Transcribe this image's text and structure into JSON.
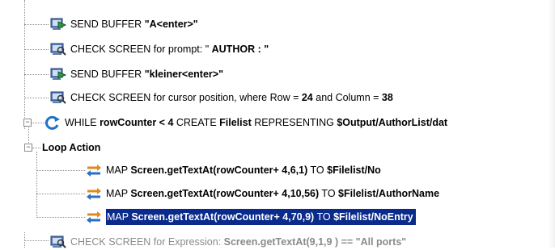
{
  "tree": {
    "selected_index": 8,
    "nodes": [
      {
        "icon": "send-buffer-icon",
        "parts": [
          {
            "t": "SEND BUFFER "
          },
          {
            "t": "\"A<enter>\"",
            "b": true
          }
        ]
      },
      {
        "icon": "check-screen-icon",
        "parts": [
          {
            "t": "CHECK SCREEN for prompt: \"           "
          },
          {
            "t": "AUTHOR : \"",
            "b": true
          }
        ]
      },
      {
        "icon": "send-buffer-icon",
        "parts": [
          {
            "t": "SEND BUFFER "
          },
          {
            "t": "\"kleiner<enter>\"",
            "b": true
          }
        ]
      },
      {
        "icon": "check-screen-icon",
        "parts": [
          {
            "t": "CHECK SCREEN for cursor position, where Row = "
          },
          {
            "t": "24",
            "b": true
          },
          {
            "t": " and Column = "
          },
          {
            "t": "38",
            "b": true
          }
        ]
      },
      {
        "icon": "while-loop-icon",
        "parts": [
          {
            "t": "WHILE "
          },
          {
            "t": "rowCounter < 4",
            "b": true
          },
          {
            "t": " CREATE "
          },
          {
            "t": "Filelist",
            "b": true
          },
          {
            "t": " REPRESENTING "
          },
          {
            "t": "$Output/AuthorList/dat",
            "b": true
          }
        ]
      },
      {
        "icon": "",
        "parts": [
          {
            "t": "Loop Action",
            "b": true
          }
        ]
      },
      {
        "icon": "map-arrows-icon",
        "parts": [
          {
            "t": "MAP "
          },
          {
            "t": "Screen.getTextAt(rowCounter+ 4,6,1)",
            "b": true
          },
          {
            "t": " TO "
          },
          {
            "t": "$Filelist/No",
            "b": true
          }
        ]
      },
      {
        "icon": "map-arrows-icon",
        "parts": [
          {
            "t": "MAP "
          },
          {
            "t": "Screen.getTextAt(rowCounter+ 4,10,56)",
            "b": true
          },
          {
            "t": " TO "
          },
          {
            "t": "$Filelist/AuthorName",
            "b": true
          }
        ]
      },
      {
        "icon": "map-arrows-icon",
        "parts": [
          {
            "t": "MAP "
          },
          {
            "t": "Screen.getTextAt(rowCounter+ 4,70,9)",
            "b": true
          },
          {
            "t": " TO "
          },
          {
            "t": "$Filelist/NoEntry",
            "b": true
          }
        ]
      },
      {
        "icon": "check-screen-icon",
        "parts": [
          {
            "t": "CHECK SCREEN for Expression: "
          },
          {
            "t": "Screen.getTextAt(9,1,9 ) == \"All ports\"",
            "b": true
          }
        ]
      }
    ]
  },
  "colors": {
    "selection": "#0a2a8c",
    "loop_arrow": "#1e73c8",
    "send_green": "#2a9a3a",
    "map_orange": "#e08a1e",
    "map_blue": "#2b6fc4"
  }
}
